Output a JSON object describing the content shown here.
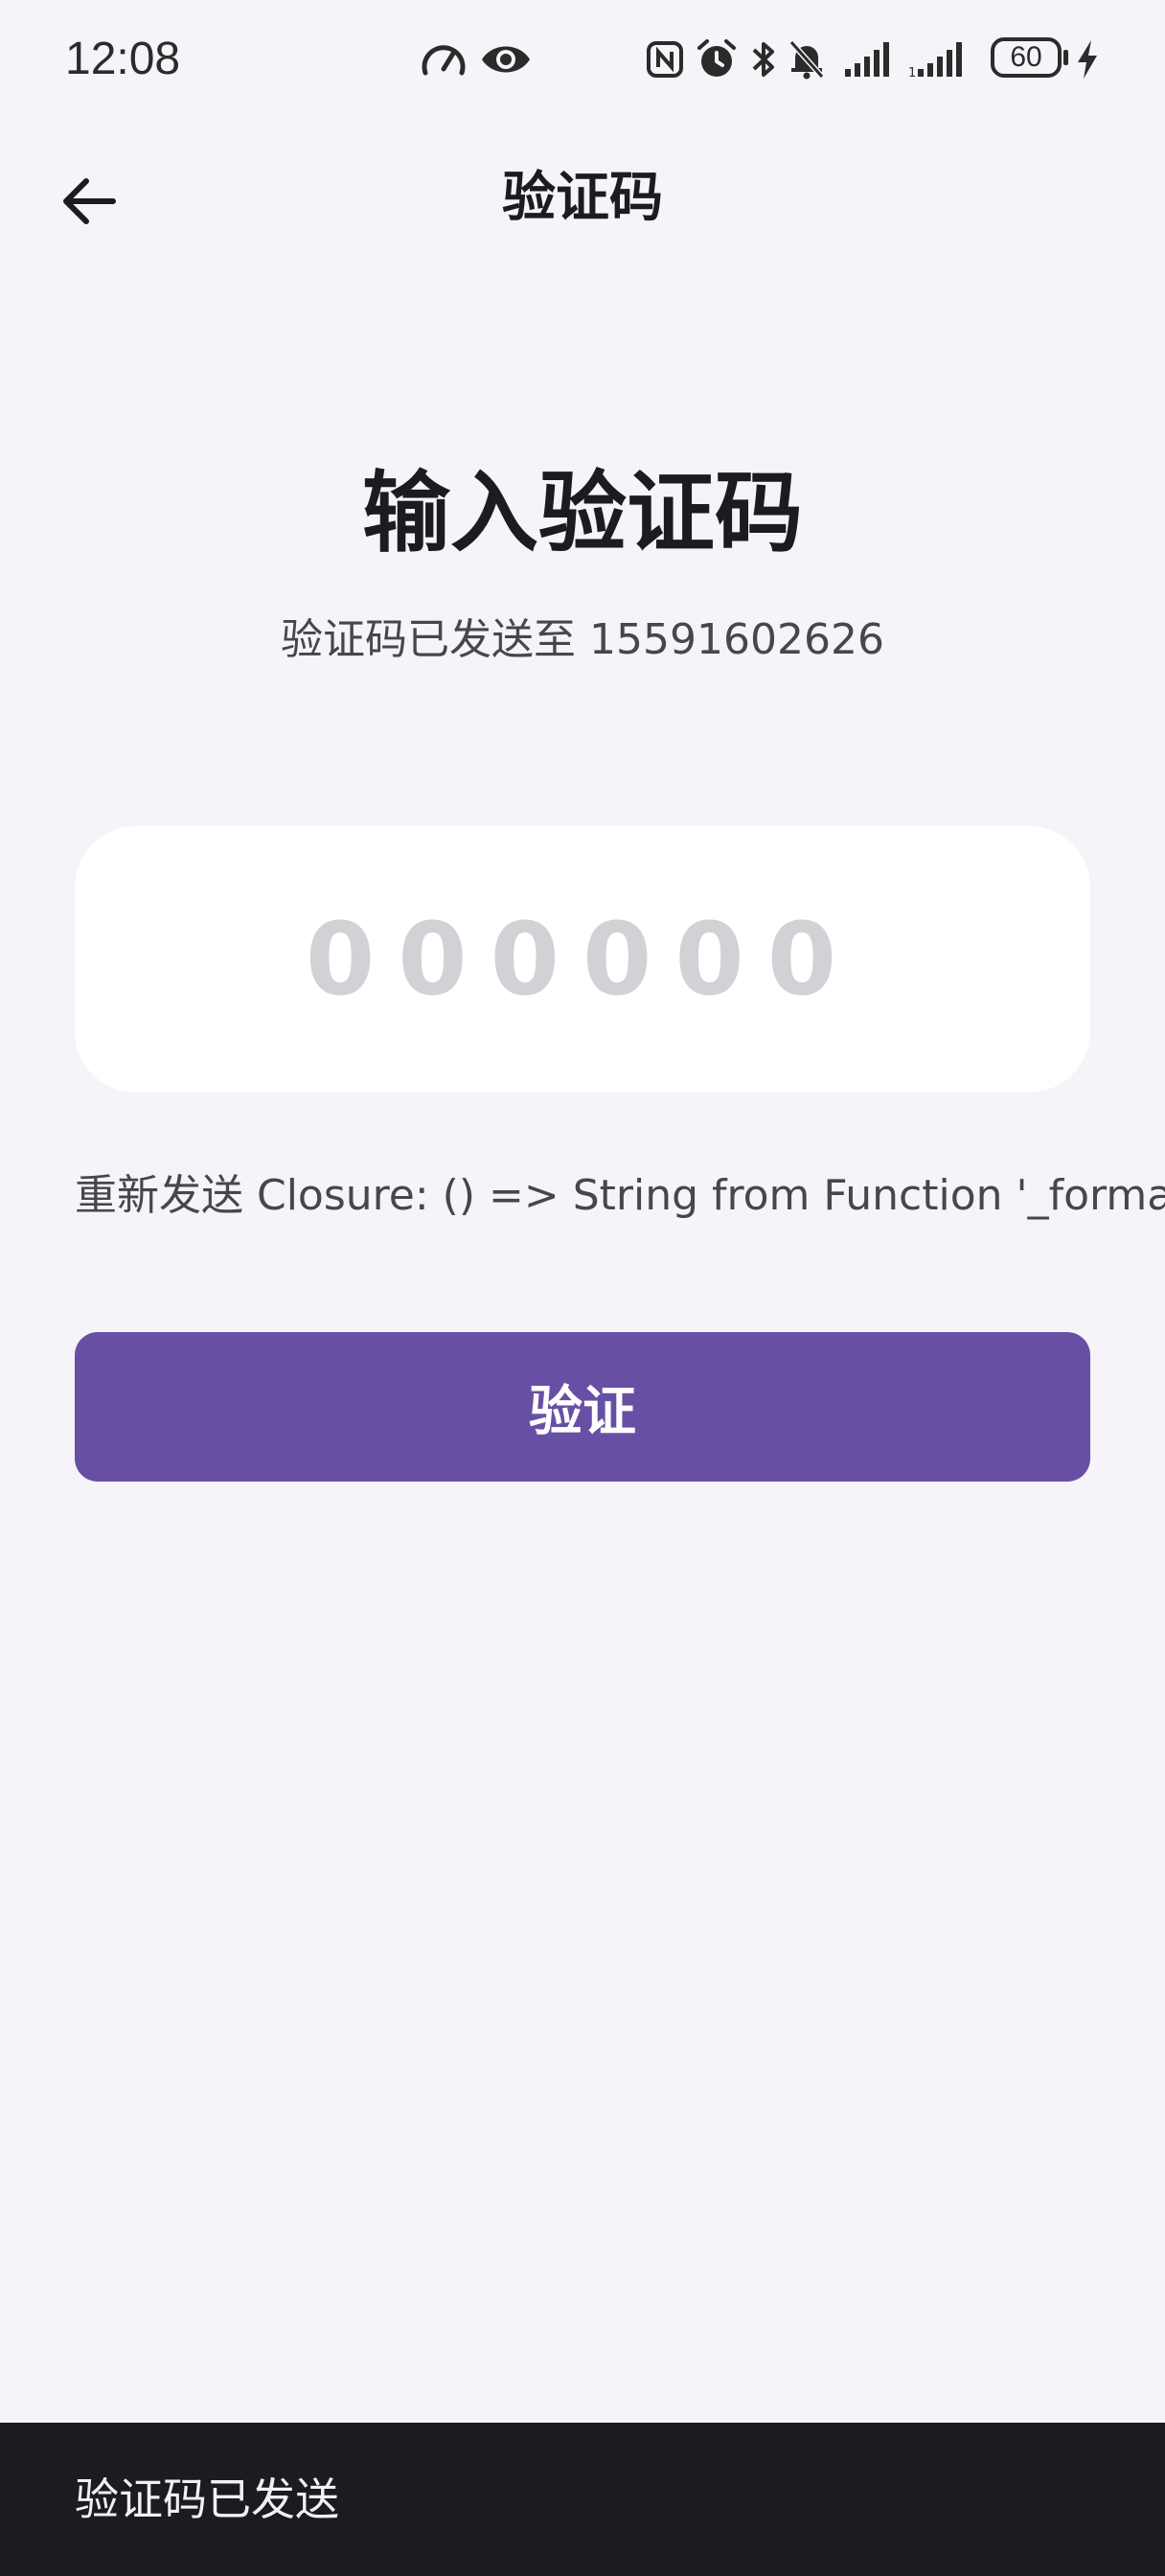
{
  "status_bar": {
    "time": "12:08",
    "battery_level": "60",
    "icons": [
      "speedometer-icon",
      "eye-icon",
      "nfc-icon",
      "alarm-icon",
      "bluetooth-icon",
      "bell-off-icon",
      "signal-icon",
      "signal-icon",
      "battery-icon",
      "charging-icon"
    ]
  },
  "app_bar": {
    "title": "验证码",
    "back_icon": "arrow-left-icon"
  },
  "main": {
    "headline": "输入验证码",
    "subtitle": "验证码已发送至 15591602626",
    "code_input": {
      "value": "",
      "placeholder": "000000"
    },
    "resend_text": "重新发送 Closure: () => String from Function '_formatTime'",
    "verify_label": "验证"
  },
  "snackbar": {
    "message": "验证码已发送"
  },
  "colors": {
    "background": "#f6f3f9",
    "primary": "#6750a4",
    "snackbar_bg": "#1c1b1f",
    "input_bg": "#ffffff",
    "placeholder": "#d2d1d5"
  }
}
